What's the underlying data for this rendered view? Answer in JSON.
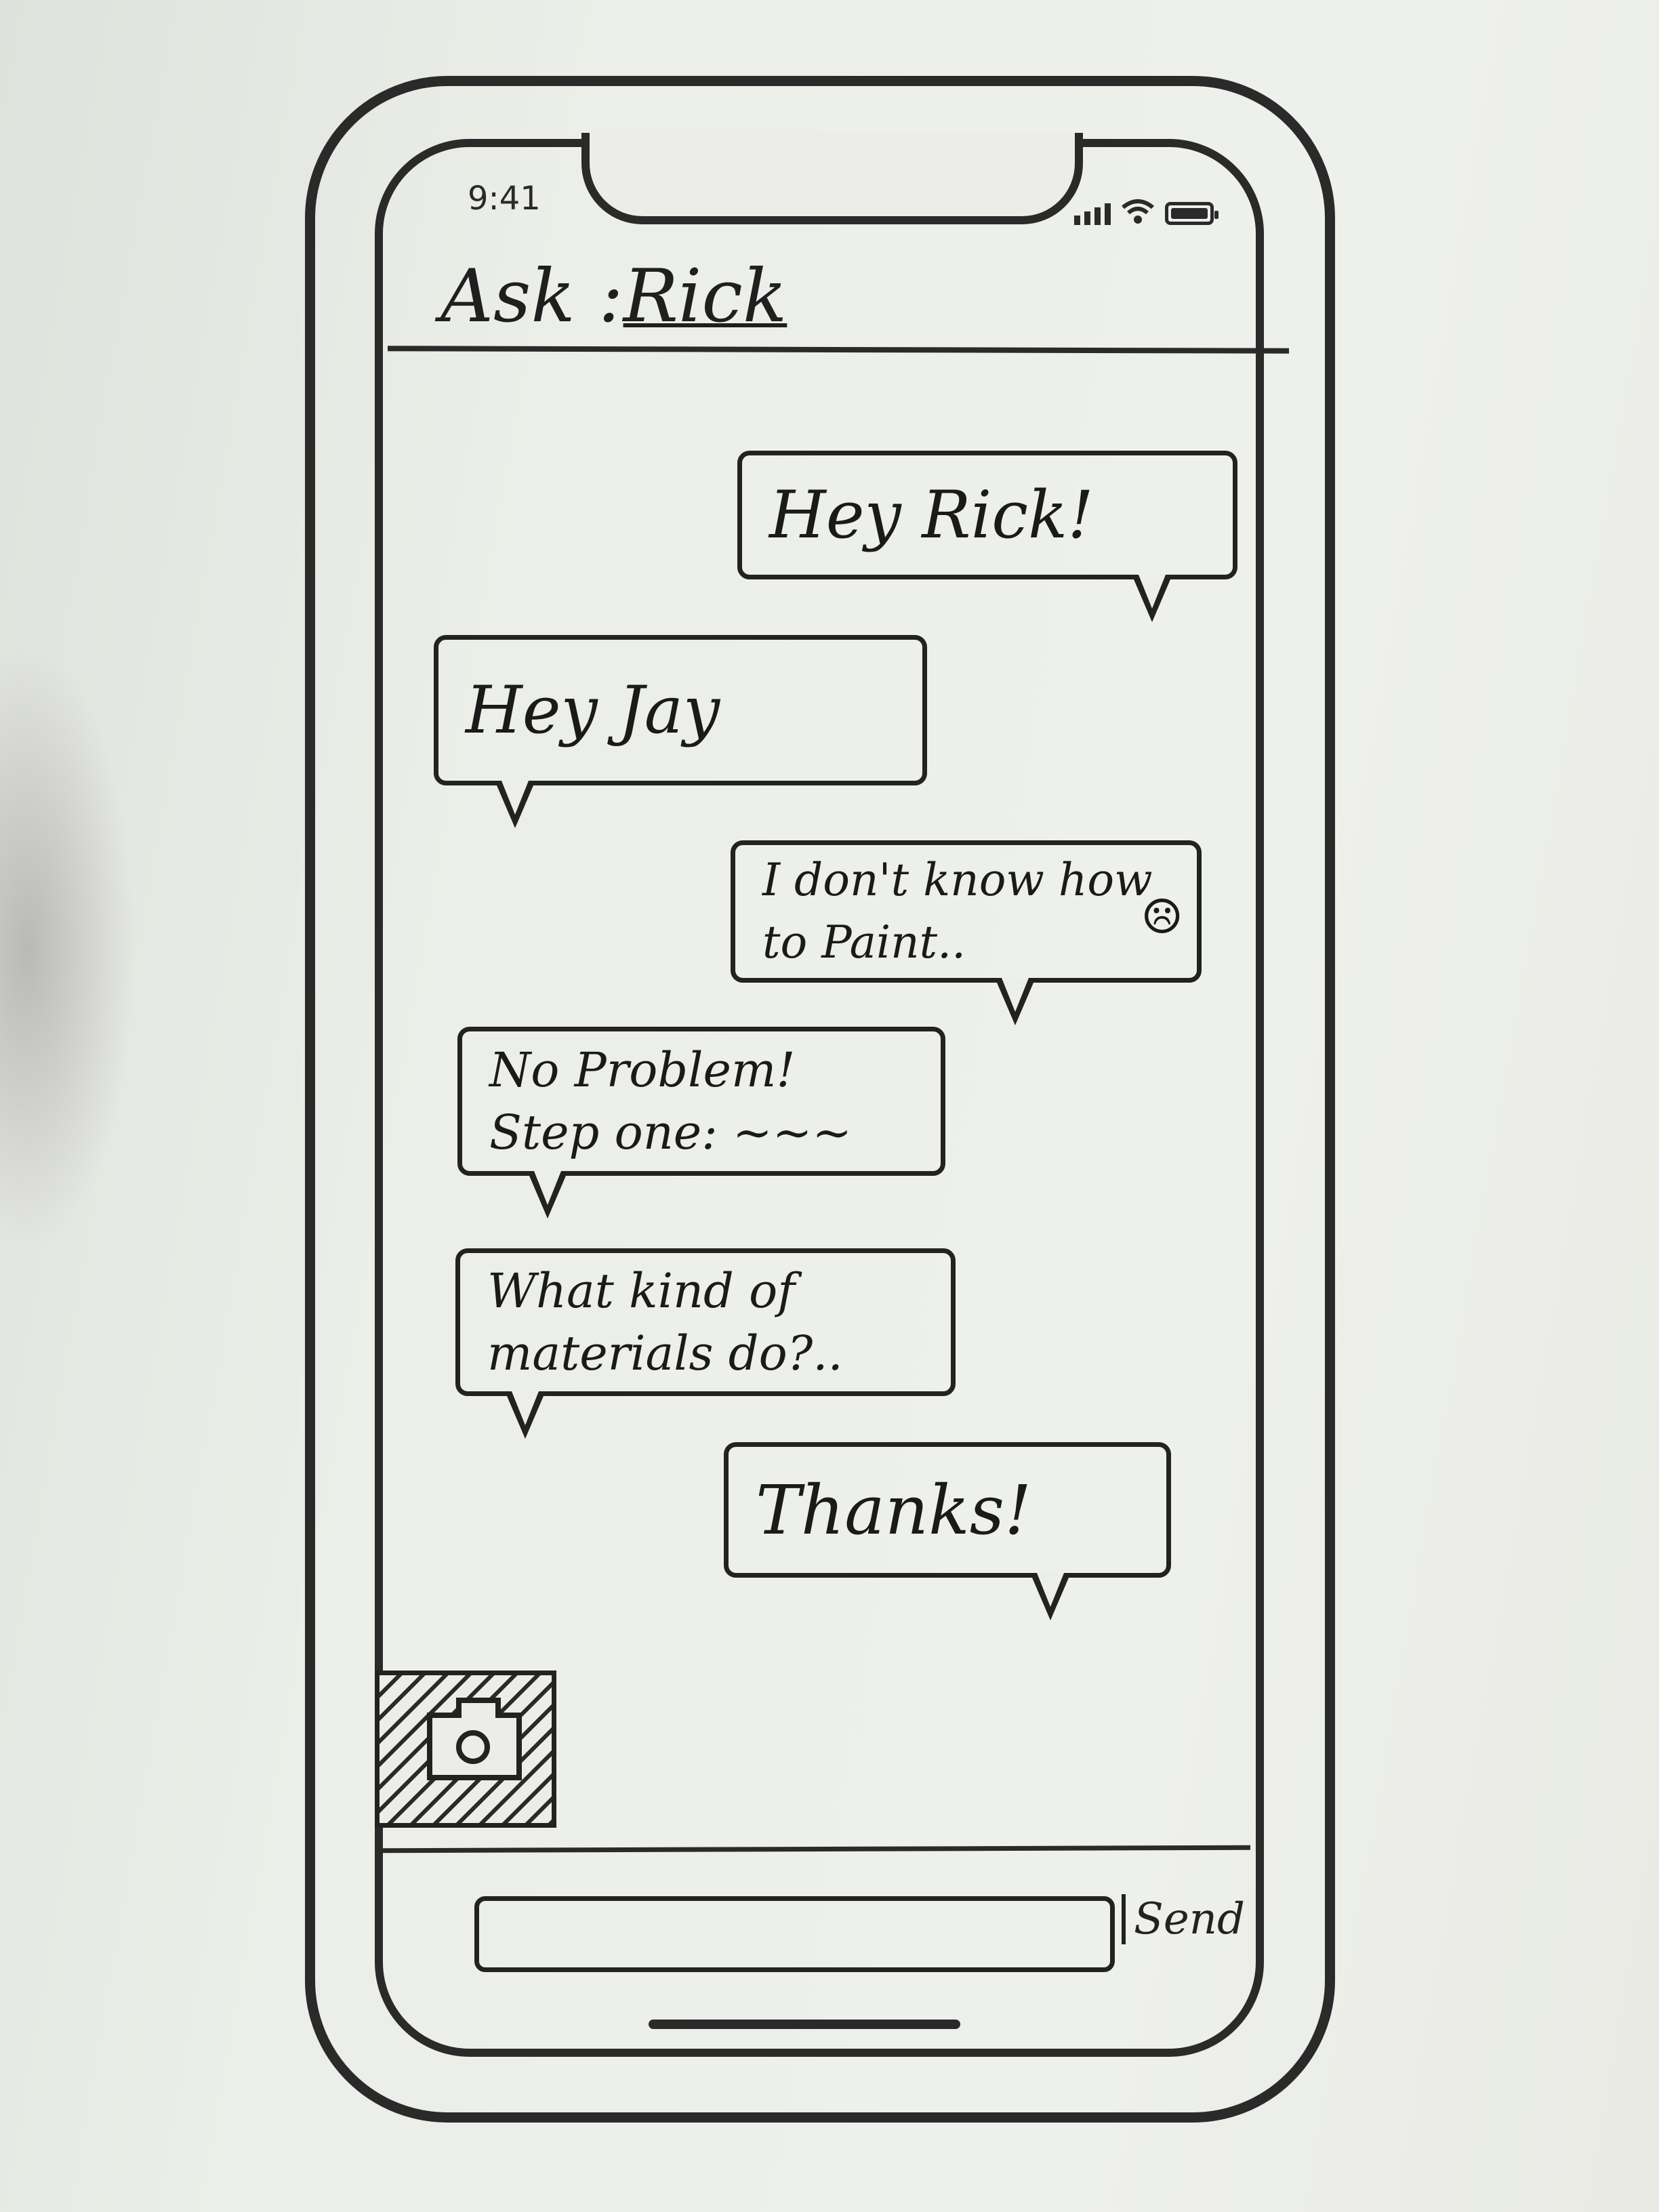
{
  "status_bar": {
    "time": "9:41",
    "icons": [
      "signal-icon",
      "wifi-icon",
      "battery-icon"
    ]
  },
  "header": {
    "prefix": "Ask :",
    "name": "Rick"
  },
  "messages": [
    {
      "side": "right",
      "text": "Hey Rick!"
    },
    {
      "side": "left",
      "text": "Hey Jay"
    },
    {
      "side": "right",
      "text": "I don't know how to Paint..",
      "emoji": "☹"
    },
    {
      "side": "left",
      "text": "No Problem! Step one: ~~~"
    },
    {
      "side": "left",
      "text": "What kind of materials do?.."
    },
    {
      "side": "right",
      "text": "Thanks!"
    }
  ],
  "composer": {
    "camera_icon": "camera-icon",
    "input_value": "",
    "send_label": "Send"
  }
}
